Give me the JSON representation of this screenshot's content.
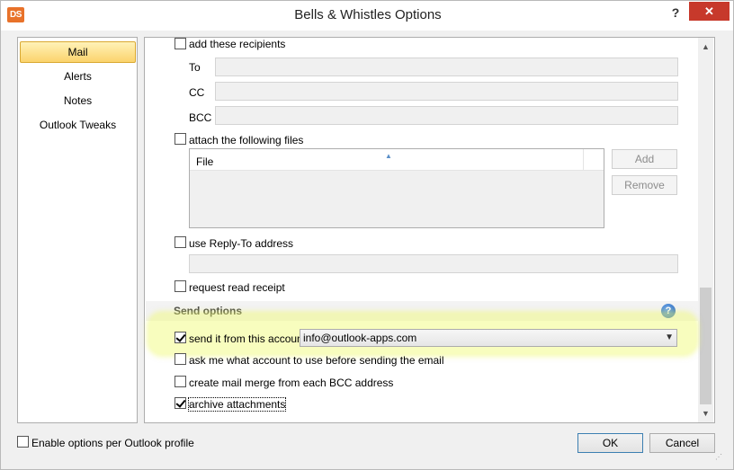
{
  "window": {
    "title": "Bells & Whistles Options",
    "app_icon_text": "DS",
    "help_label": "?",
    "close_label": "✕"
  },
  "nav": {
    "items": [
      {
        "label": "Mail",
        "active": true
      },
      {
        "label": "Alerts",
        "active": false
      },
      {
        "label": "Notes",
        "active": false
      },
      {
        "label": "Outlook Tweaks",
        "active": false
      }
    ]
  },
  "recipients": {
    "checkbox_label": "add these recipients",
    "checked": false,
    "to_label": "To",
    "to_value": "",
    "cc_label": "CC",
    "cc_value": "",
    "bcc_label": "BCC",
    "bcc_value": ""
  },
  "attach": {
    "checkbox_label": "attach the following files",
    "checked": false,
    "column_header": "File",
    "add_label": "Add",
    "remove_label": "Remove"
  },
  "reply_to": {
    "checkbox_label": "use Reply-To address",
    "checked": false,
    "value": ""
  },
  "read_receipt": {
    "checkbox_label": "request read receipt",
    "checked": false
  },
  "send_options": {
    "title": "Send options",
    "help_icon_label": "?",
    "send_from": {
      "checkbox_label": "send it from this account",
      "checked": true,
      "account": "info@outlook-apps.com"
    },
    "ask_account": {
      "checkbox_label": "ask me what account to use before sending the email",
      "checked": false
    },
    "mail_merge": {
      "checkbox_label": "create mail merge from each BCC address",
      "checked": false
    },
    "archive": {
      "checkbox_label": "archive attachments",
      "checked": true
    }
  },
  "footer": {
    "profile_checkbox_label": "Enable options per Outlook profile",
    "profile_checked": false,
    "ok_label": "OK",
    "cancel_label": "Cancel"
  },
  "colors": {
    "close_button": "#c7392b",
    "nav_active": "#fbd36c",
    "highlight": "#f0fa6e",
    "help_icon": "#1f5fb8"
  }
}
